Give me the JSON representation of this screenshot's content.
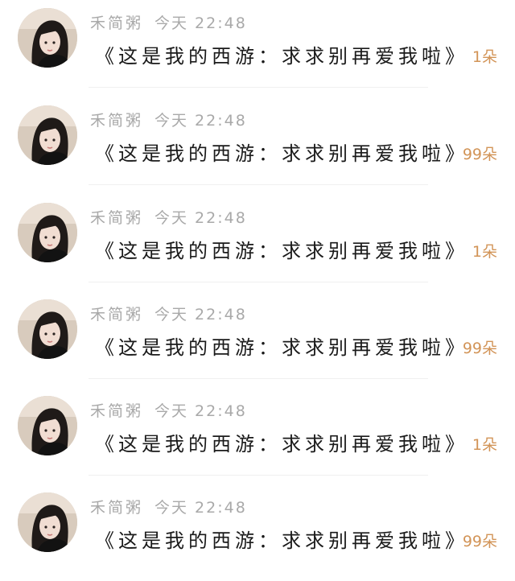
{
  "comments": [
    {
      "avatar": "avatar-photo",
      "username": "禾简粥",
      "time": "今天 22:48",
      "title": "《这是我的西游：求求别再爱我啦》",
      "count": "1朵"
    },
    {
      "avatar": "avatar-photo",
      "username": "禾简粥",
      "time": "今天 22:48",
      "title": "《这是我的西游：求求别再爱我啦》",
      "count": "99朵"
    },
    {
      "avatar": "avatar-photo",
      "username": "禾简粥",
      "time": "今天 22:48",
      "title": "《这是我的西游：求求别再爱我啦》",
      "count": "1朵"
    },
    {
      "avatar": "avatar-photo",
      "username": "禾简粥",
      "time": "今天 22:48",
      "title": "《这是我的西游：求求别再爱我啦》",
      "count": "99朵"
    },
    {
      "avatar": "avatar-photo",
      "username": "禾简粥",
      "time": "今天 22:48",
      "title": "《这是我的西游：求求别再爱我啦》",
      "count": "1朵"
    },
    {
      "avatar": "avatar-photo",
      "username": "禾简粥",
      "time": "今天 22:48",
      "title": "《这是我的西游：求求别再爱我啦》",
      "count": "99朵"
    }
  ],
  "colors": {
    "username_time": "#a9a9a9",
    "title": "#1a1a1a",
    "count": "#d29457",
    "divider": "#f0f0f0"
  }
}
